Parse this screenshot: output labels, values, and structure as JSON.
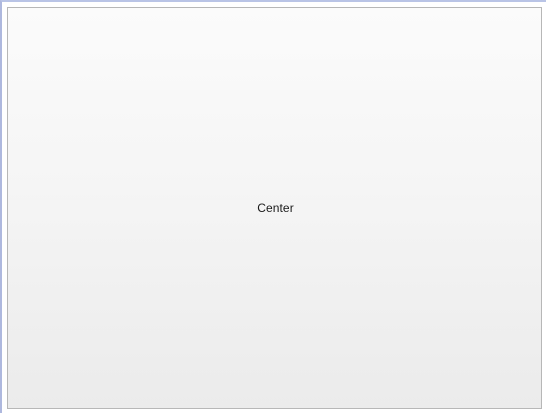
{
  "panel": {
    "label": "Center"
  },
  "colors": {
    "window_border": "#b9c4e6",
    "panel_border": "#b7b7b7",
    "panel_gradient_top": "#fbfbfb",
    "panel_gradient_bottom": "#ebebeb",
    "text": "#1a1a1a"
  }
}
